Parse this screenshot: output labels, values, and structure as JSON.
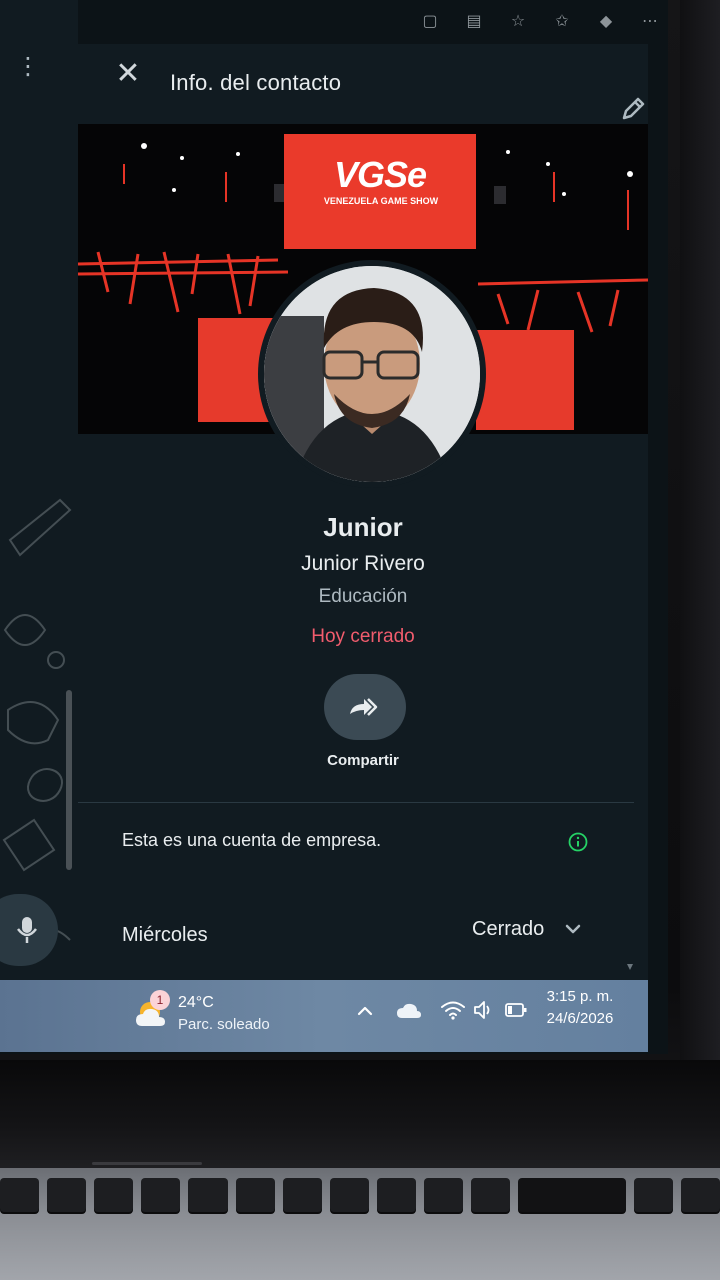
{
  "drawer": {
    "title": "Info. del contacto",
    "cover_logo": "VGSe",
    "cover_logo_sub": "VENEZUELA GAME SHOW"
  },
  "profile": {
    "name": "Junior",
    "full_name": "Junior Rivero",
    "category": "Educación",
    "status": "Hoy cerrado"
  },
  "share": {
    "label": "Compartir"
  },
  "business": {
    "note": "Esta es una cuenta de empresa."
  },
  "hours": {
    "day": "Miércoles",
    "state": "Cerrado"
  },
  "taskbar": {
    "weather_badge": "1",
    "temperature": "24°C",
    "weather": "Parc. soleado",
    "time": "3:15 p. m.",
    "date": "24/6/2026"
  },
  "icons": {
    "close": "close-icon",
    "edit": "pencil-icon",
    "share": "forward-icon",
    "info": "info-icon",
    "chevron": "chevron-down-icon",
    "mic": "mic-icon",
    "menu": "kebab-menu-icon"
  },
  "colors": {
    "panel": "#111b21",
    "status_closed": "#f15c6d",
    "info_accent": "#25d366",
    "share_button": "#3b4a54",
    "cover_red": "#e63a2c",
    "taskbar": "#6e88a4"
  }
}
